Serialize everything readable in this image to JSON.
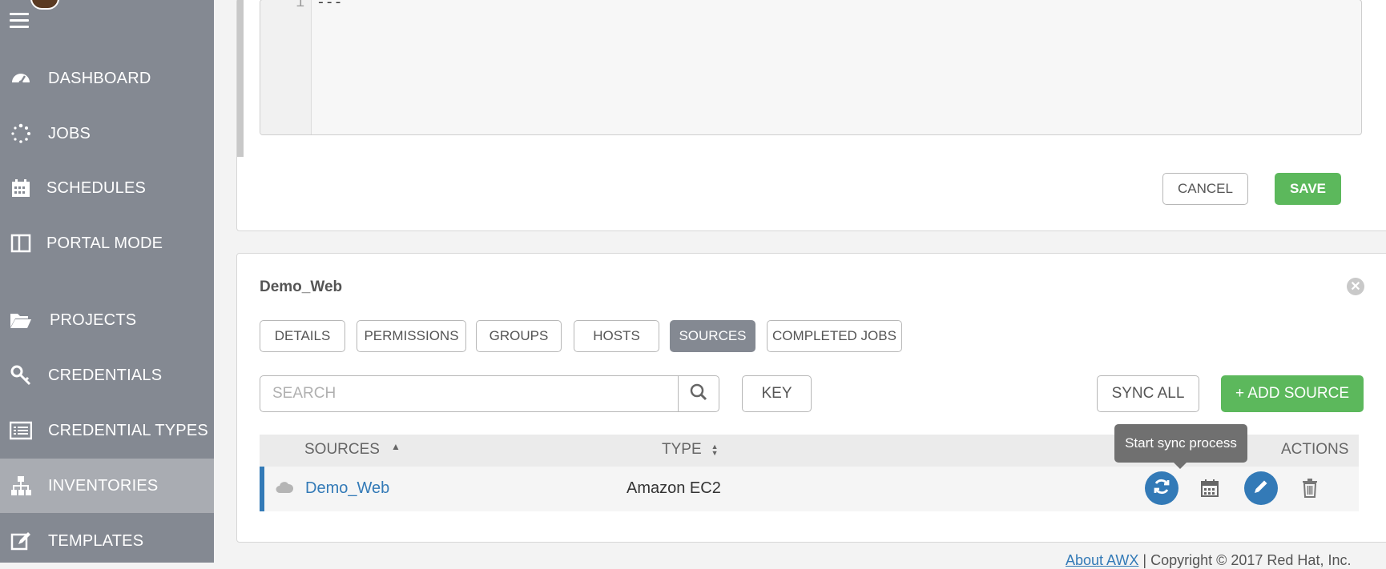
{
  "sidebar": {
    "items": [
      {
        "label": "DASHBOARD",
        "icon": "dashboard-icon"
      },
      {
        "label": "JOBS",
        "icon": "jobs-spinner-icon"
      },
      {
        "label": "SCHEDULES",
        "icon": "calendar-icon"
      },
      {
        "label": "PORTAL MODE",
        "icon": "portal-icon"
      },
      {
        "label": "PROJECTS",
        "icon": "folder-open-icon"
      },
      {
        "label": "CREDENTIALS",
        "icon": "key-icon"
      },
      {
        "label": "CREDENTIAL TYPES",
        "icon": "list-icon"
      },
      {
        "label": "INVENTORIES",
        "icon": "sitemap-icon",
        "active": true
      },
      {
        "label": "TEMPLATES",
        "icon": "edit-icon"
      }
    ]
  },
  "editor": {
    "line_number": "1",
    "content": "---"
  },
  "form_actions": {
    "cancel": "CANCEL",
    "save": "SAVE"
  },
  "inventory": {
    "title": "Demo_Web",
    "tabs": [
      "DETAILS",
      "PERMISSIONS",
      "GROUPS",
      "HOSTS",
      "SOURCES",
      "COMPLETED JOBS"
    ],
    "active_tab": "SOURCES"
  },
  "toolbar": {
    "search_placeholder": "SEARCH",
    "key": "KEY",
    "sync_all": "SYNC ALL",
    "add_source": "+ ADD SOURCE"
  },
  "table": {
    "headers": {
      "sources": "SOURCES",
      "type": "TYPE",
      "actions": "ACTIONS"
    },
    "rows": [
      {
        "name": "Demo_Web",
        "type": "Amazon EC2"
      }
    ]
  },
  "tooltip": "Start sync process",
  "footer": {
    "about": "About AWX",
    "copyright": " | Copyright © 2017 Red Hat, Inc."
  },
  "colors": {
    "sidebar": "#848992",
    "active_nav": "#a9acb2",
    "primary": "#337ab7",
    "success": "#5cb85c"
  }
}
